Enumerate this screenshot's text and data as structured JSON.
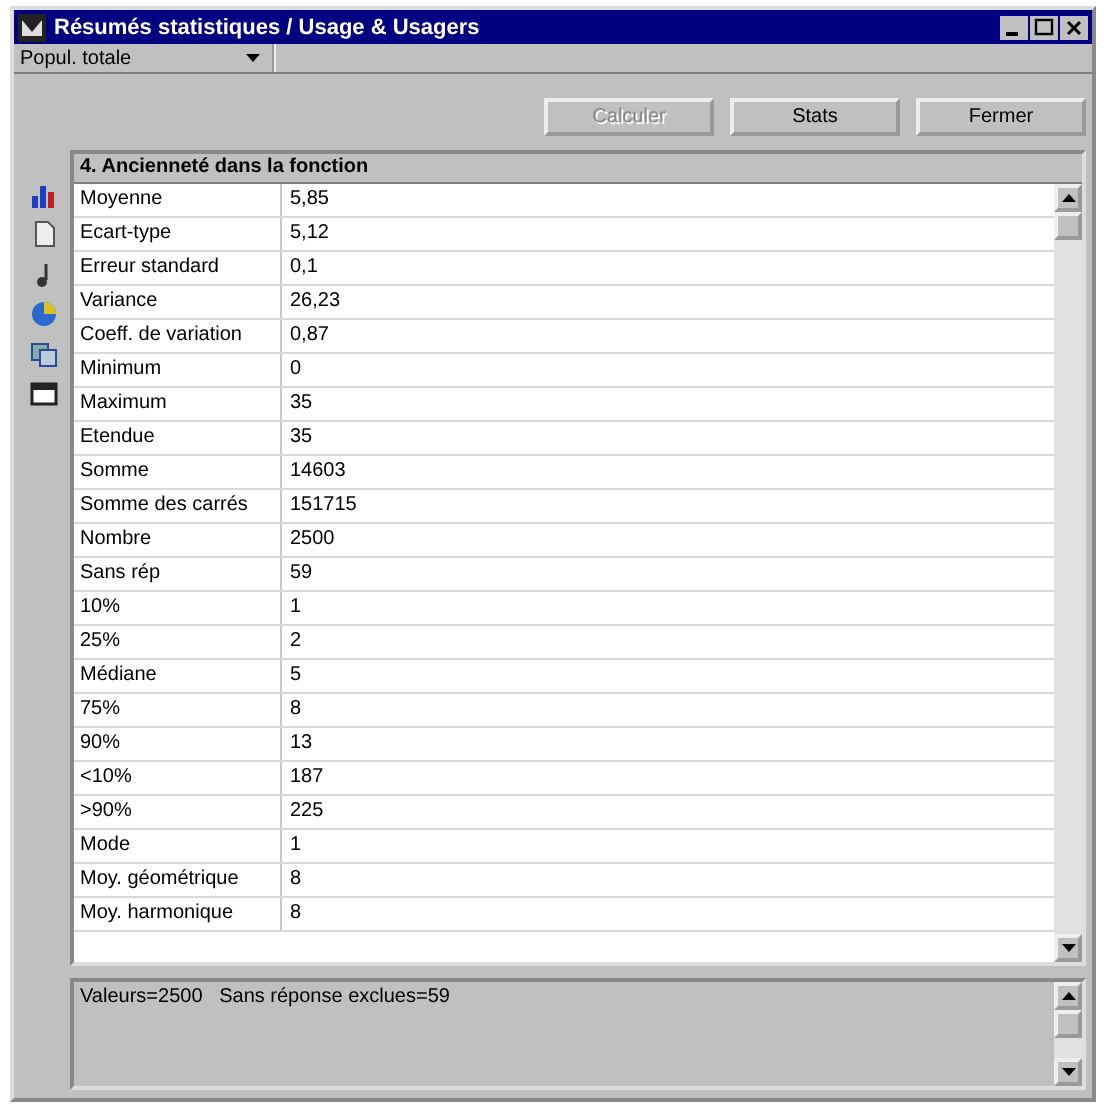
{
  "window": {
    "title": "Résumés statistiques / Usage & Usagers"
  },
  "population_select": {
    "value": "Popul. totale"
  },
  "buttons": [
    {
      "label": "Calculer",
      "disabled": true
    },
    {
      "label": "Stats",
      "disabled": false
    },
    {
      "label": "Fermer",
      "disabled": false
    }
  ],
  "table": {
    "title": "4. Ancienneté dans la fonction",
    "rows": [
      {
        "label": "Moyenne",
        "value": "5,85"
      },
      {
        "label": "Ecart-type",
        "value": "5,12"
      },
      {
        "label": "Erreur standard",
        "value": "0,1"
      },
      {
        "label": "Variance",
        "value": "26,23"
      },
      {
        "label": "Coeff. de variation",
        "value": "0,87"
      },
      {
        "label": "Minimum",
        "value": "0"
      },
      {
        "label": "Maximum",
        "value": "35"
      },
      {
        "label": "Etendue",
        "value": "35"
      },
      {
        "label": "Somme",
        "value": "14603"
      },
      {
        "label": "Somme des carrés",
        "value": "151715"
      },
      {
        "label": "Nombre",
        "value": "2500"
      },
      {
        "label": "Sans rép",
        "value": "59"
      },
      {
        "label": "10%",
        "value": "1"
      },
      {
        "label": "25%",
        "value": "2"
      },
      {
        "label": "Médiane",
        "value": "5"
      },
      {
        "label": "75%",
        "value": "8"
      },
      {
        "label": "90%",
        "value": "13"
      },
      {
        "label": "<10%",
        "value": "187"
      },
      {
        "label": ">90%",
        "value": "225"
      },
      {
        "label": "Mode",
        "value": "1"
      },
      {
        "label": "Moy. géométrique",
        "value": "8"
      },
      {
        "label": "Moy. harmonique",
        "value": "8"
      }
    ]
  },
  "status_text": "Valeurs=2500   Sans réponse exclues=59"
}
